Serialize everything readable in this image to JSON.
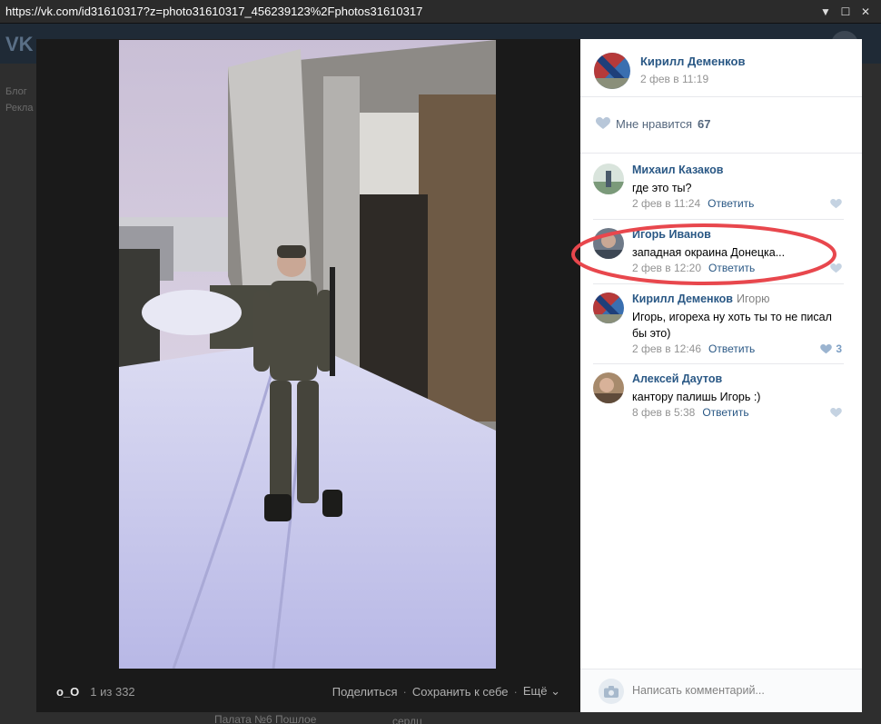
{
  "browser": {
    "url": "https://vk.com/id31610317?z=photo31610317_456239123%2Fphotos31610317",
    "controls": [
      "▼",
      "☐",
      "✕"
    ]
  },
  "background": {
    "logo": "VK",
    "left_items": [
      "Блог",
      "Рекла"
    ],
    "bottom_text": "Палата №6 Пошлое",
    "bottom_text2": "сердц"
  },
  "viewer": {
    "owner": "o_O",
    "counter": "1 из 332",
    "actions": {
      "share": "Поделиться",
      "save": "Сохранить к себе",
      "more": "Ещё"
    }
  },
  "post": {
    "author": "Кирилл Деменков",
    "date": "2 фев в 11:19",
    "likes_label": "Мне нравится",
    "likes_count": "67"
  },
  "comments": [
    {
      "name": "Михаил Казаков",
      "reply_to": "",
      "text": "где это ты?",
      "date": "2 фев в 11:24",
      "reply": "Ответить",
      "likes": ""
    },
    {
      "name": "Игорь Иванов",
      "reply_to": "",
      "text": "западная окраина Донецка...",
      "date": "2 фев в 12:20",
      "reply": "Ответить",
      "likes": ""
    },
    {
      "name": "Кирилл Деменков",
      "reply_to": "Игорю",
      "text": "Игорь, игореха ну хоть ты то не писал бы это)",
      "date": "2 фев в 12:46",
      "reply": "Ответить",
      "likes": "3"
    },
    {
      "name": "Алексей Даутов",
      "reply_to": "",
      "text": "кантору палишь Игорь :)",
      "date": "8 фев в 5:38",
      "reply": "Ответить",
      "likes": ""
    }
  ],
  "composer": {
    "placeholder": "Написать комментарий..."
  },
  "colors": {
    "link": "#2a5885",
    "muted": "#939393",
    "annotation": "#e8474d"
  }
}
